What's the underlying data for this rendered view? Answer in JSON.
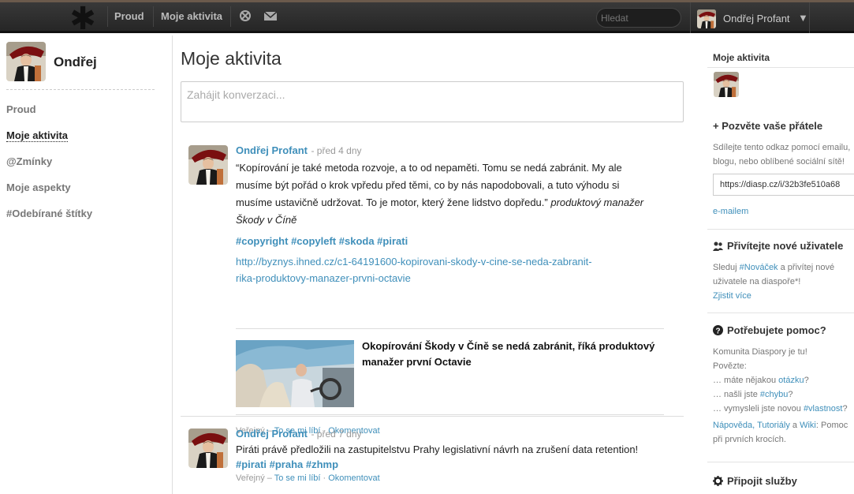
{
  "topbar": {
    "nav": [
      "Proud",
      "Moje aktivita"
    ],
    "search_placeholder": "Hledat",
    "user_name": "Ondřej Profant",
    "caret": "▼"
  },
  "left": {
    "name": "Ondřej",
    "items": [
      "Proud",
      "Moje aktivita",
      "@Zmínky",
      "Moje aspekty",
      "#Odebírané štítky"
    ]
  },
  "main": {
    "title": "Moje aktivita",
    "publisher_placeholder": "Zahájit konverzaci..."
  },
  "posts": [
    {
      "author": "Ondřej Profant",
      "time": "- před 4 dny",
      "text_line1": "“Kopírování je také metoda rozvoje, a to od nepaměti. Tomu se nedá zabránit. My ale",
      "text_line2": "musíme být pořád o krok vpředu před těmi, co by nás napodobovali, a tuto výhodu si",
      "text_line3": "musíme ustavičně udržovat. To je motor, který žene lidstvo dopředu.”",
      "text_italic1": "produktový manažer",
      "text_italic2": "Škody v Číně",
      "tags": "#copyright #copyleft #skoda #pirati",
      "link1": "http://byznys.ihned.cz/c1-64191600-kopirovani-skody-v-cine-se-neda-zabranit-",
      "link2": "rika-produktovy-manazer-prvni-octavie",
      "oembed_title1": "Okopírování Škody v Číně se nedá zabránit, říká produktový",
      "oembed_title2": "manažer první Octavie",
      "meta_public": "Veřejný –",
      "meta_like": "To se mi líbí",
      "meta_dot": "·",
      "meta_comment": "Okomentovat"
    },
    {
      "author": "Ondřej Profant",
      "time": "- před 7 dny",
      "text": "Piráti právě předložili na zastupitelstvu Prahy legislativní návrh na zrušení data retention!",
      "tags": "#pirati #praha #zhmp",
      "meta_public": "Veřejný –",
      "meta_like": "To se mi líbí",
      "meta_dot": "·",
      "meta_comment": "Okomentovat"
    }
  ],
  "right": {
    "my_activity": "Moje aktivita",
    "invite_head": "+ Pozvěte vaše přátele",
    "invite_text1": "Sdílejte tento odkaz pomocí emailu,",
    "invite_text2": "blogu, nebo oblíbené sociální sítě!",
    "invite_url": "https://diasp.cz/i/32b3fe510a68",
    "invite_email": "e-mailem",
    "welcome_head": "Přivítejte nové uživatele",
    "welcome_text1a": "Sleduj",
    "welcome_tag": "#Nováček",
    "welcome_text1b": "a přivítej nové",
    "welcome_text2": "uživatele na diaspoře*!",
    "welcome_more": "Zjistit více",
    "help_head": "Potřebujete pomoc?",
    "help_l1": "Komunita Diaspory je tu!",
    "help_l2": "Povězte:",
    "help_l3a": "… máte nějakou",
    "help_l3b": "otázku",
    "help_l3c": "?",
    "help_l4a": "… našli jste",
    "help_l4b": "#chybu",
    "help_l4c": "?",
    "help_l5a": "… vymysleli jste novou",
    "help_l5b": "#vlastnost",
    "help_l5c": "?",
    "help_l6a": "Nápověda",
    "help_l6b": ",",
    "help_l6c": "Tutoriály",
    "help_l6d": "a",
    "help_l6e": "Wiki",
    "help_l6f": ": Pomoc",
    "help_l7": "při prvních krocích.",
    "services_head": "Připojit služby"
  },
  "colors": {
    "accent": "#3f8fba",
    "topbar": "#2b2b2b"
  }
}
